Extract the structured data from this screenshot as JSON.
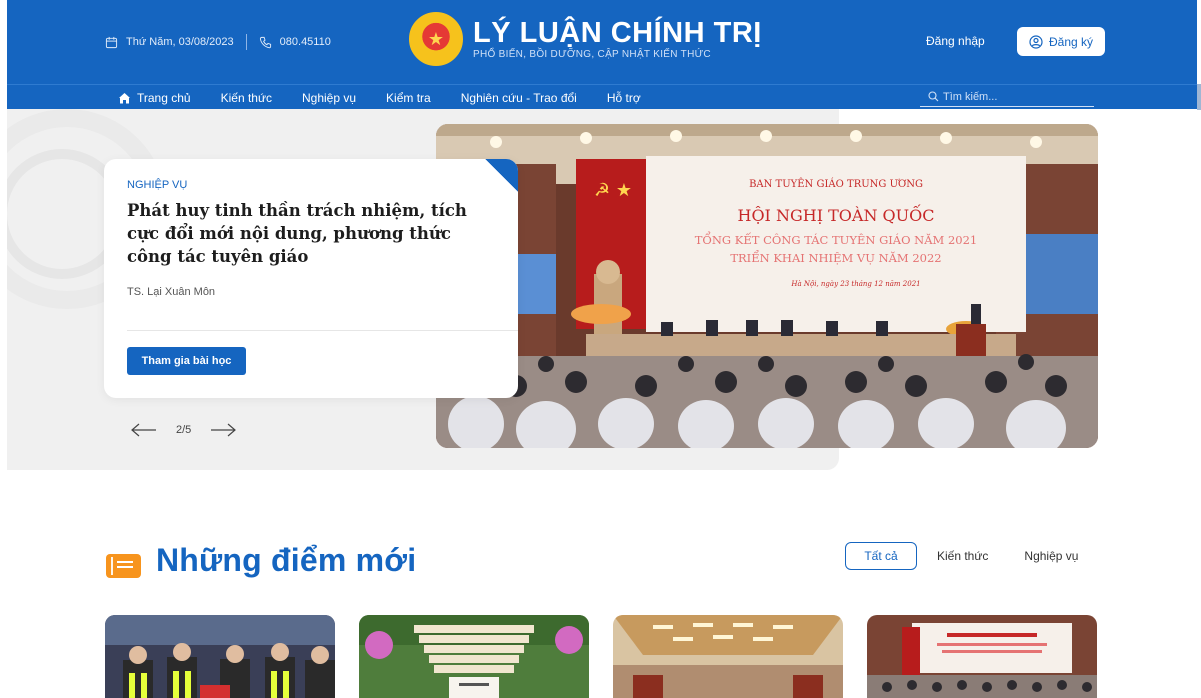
{
  "header": {
    "date": "Thứ Năm, 03/08/2023",
    "phone": "080.45110",
    "brand_title": "LÝ LUẬN CHÍNH TRỊ",
    "brand_subtitle": "PHỔ BIẾN, BỒI DƯỠNG, CẬP NHẬT KIẾN THỨC",
    "login_label": "Đăng nhập",
    "register_label": "Đăng ký",
    "colors": {
      "primary": "#1565c0",
      "accent": "#f7941d"
    }
  },
  "nav": {
    "items": [
      {
        "label": "Trang chủ",
        "icon": "home-icon",
        "active": true
      },
      {
        "label": "Kiến thức"
      },
      {
        "label": "Nghiệp vụ"
      },
      {
        "label": "Kiểm tra"
      },
      {
        "label": "Nghiên cứu - Trao đổi"
      },
      {
        "label": "Hỗ trợ"
      }
    ],
    "search_placeholder": "Tìm kiếm..."
  },
  "hero": {
    "category": "NGHIỆP VỤ",
    "title": "Phát huy tinh thần trách nhiệm, tích cực đổi mới nội dung, phương thức công tác tuyên giáo",
    "author": "TS. Lại Xuân Môn",
    "cta_label": "Tham gia bài học",
    "pager": "2/5",
    "image_banner": {
      "line1": "BAN TUYÊN GIÁO TRUNG ƯƠNG",
      "line2": "HỘI NGHỊ TOÀN QUỐC",
      "line3": "TỔNG KẾT CÔNG TÁC TUYÊN GIÁO NĂM 2021",
      "line4": "TRIỂN KHAI NHIỆM VỤ NĂM 2022",
      "line5": "Hà Nội, ngày 23 tháng 12 năm 2021"
    }
  },
  "news": {
    "section_title": "Những điểm mới",
    "filters": [
      "Tất cả",
      "Kiến thức",
      "Nghiệp vụ"
    ],
    "active_filter": "Tất cả"
  }
}
